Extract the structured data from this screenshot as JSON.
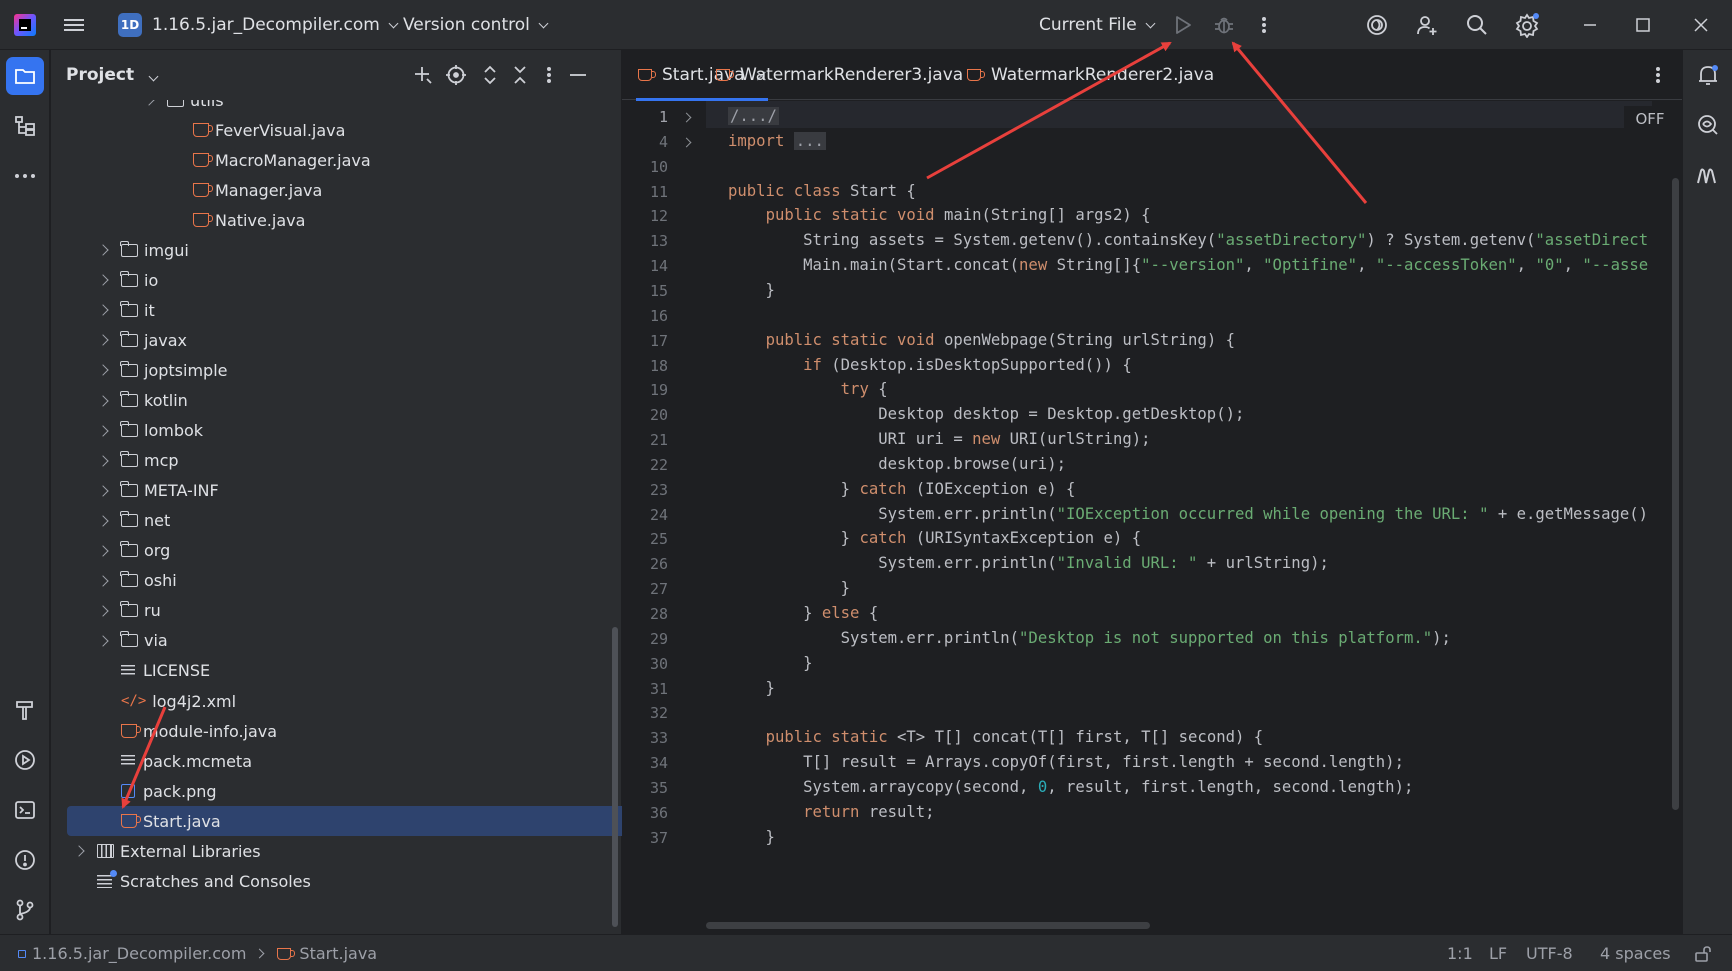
{
  "titlebar": {
    "project_badge": "1D",
    "project_name": "1.16.5.jar_Decompiler.com",
    "version_control": "Version control",
    "run_config": "Current File"
  },
  "project_panel": {
    "title": "Project",
    "tree": [
      {
        "label": "utils",
        "type": "folder",
        "depth": 2,
        "expandable": true
      },
      {
        "label": "FeverVisual.java",
        "type": "java",
        "depth": 3
      },
      {
        "label": "MacroManager.java",
        "type": "java",
        "depth": 3
      },
      {
        "label": "Manager.java",
        "type": "java",
        "depth": 3
      },
      {
        "label": "Native.java",
        "type": "java",
        "depth": 3
      },
      {
        "label": "imgui",
        "type": "folder",
        "depth": 1,
        "expandable": true
      },
      {
        "label": "io",
        "type": "folder",
        "depth": 1,
        "expandable": true
      },
      {
        "label": "it",
        "type": "folder",
        "depth": 1,
        "expandable": true
      },
      {
        "label": "javax",
        "type": "folder",
        "depth": 1,
        "expandable": true
      },
      {
        "label": "joptsimple",
        "type": "folder",
        "depth": 1,
        "expandable": true
      },
      {
        "label": "kotlin",
        "type": "folder",
        "depth": 1,
        "expandable": true
      },
      {
        "label": "lombok",
        "type": "folder",
        "depth": 1,
        "expandable": true
      },
      {
        "label": "mcp",
        "type": "folder",
        "depth": 1,
        "expandable": true
      },
      {
        "label": "META-INF",
        "type": "folder",
        "depth": 1,
        "expandable": true
      },
      {
        "label": "net",
        "type": "folder",
        "depth": 1,
        "expandable": true
      },
      {
        "label": "org",
        "type": "folder",
        "depth": 1,
        "expandable": true
      },
      {
        "label": "oshi",
        "type": "folder",
        "depth": 1,
        "expandable": true
      },
      {
        "label": "ru",
        "type": "folder",
        "depth": 1,
        "expandable": true
      },
      {
        "label": "via",
        "type": "folder",
        "depth": 1,
        "expandable": true
      },
      {
        "label": "LICENSE",
        "type": "text",
        "depth": 1
      },
      {
        "label": "log4j2.xml",
        "type": "xml",
        "depth": 1
      },
      {
        "label": "module-info.java",
        "type": "java",
        "depth": 1
      },
      {
        "label": "pack.mcmeta",
        "type": "text",
        "depth": 1
      },
      {
        "label": "pack.png",
        "type": "image",
        "depth": 1
      },
      {
        "label": "Start.java",
        "type": "java",
        "depth": 1,
        "selected": true
      },
      {
        "label": "External Libraries",
        "type": "library",
        "depth": 0,
        "expandable": true
      },
      {
        "label": "Scratches and Consoles",
        "type": "scratch",
        "depth": 0
      }
    ]
  },
  "editor": {
    "tabs": [
      {
        "label": "Start.java",
        "active": true
      },
      {
        "label": "WatermarkRenderer3.java",
        "active": false
      },
      {
        "label": "WatermarkRenderer2.java",
        "active": false
      }
    ],
    "tab_close_glyph": "×",
    "off_badge": "OFF",
    "lines": [
      {
        "n": "1",
        "fold": true,
        "html": "<span class=\"fold-box\">/.../</span>"
      },
      {
        "n": "4",
        "fold": true,
        "html": "<span class=\"kw\">import</span> <span class=\"fold-box\">...</span>"
      },
      {
        "n": "10",
        "html": ""
      },
      {
        "n": "11",
        "html": "<span class=\"kw\">public class</span> Start {"
      },
      {
        "n": "12",
        "html": "    <span class=\"kw\">public static void</span> main(String[] args2) {"
      },
      {
        "n": "13",
        "html": "        String assets = System.getenv().containsKey(<span class=\"str\">\"assetDirectory\"</span>) ? System.getenv(<span class=\"str\">\"assetDirect</span>"
      },
      {
        "n": "14",
        "html": "        Main.main(Start.concat(<span class=\"kw\">new</span> String[]{<span class=\"str\">\"--version\"</span>, <span class=\"str\">\"Optifine\"</span>, <span class=\"str\">\"--accessToken\"</span>, <span class=\"str\">\"0\"</span>, <span class=\"str\">\"--asse</span>"
      },
      {
        "n": "15",
        "html": "    }"
      },
      {
        "n": "16",
        "html": ""
      },
      {
        "n": "17",
        "html": "    <span class=\"kw\">public static void</span> openWebpage(String urlString) {"
      },
      {
        "n": "18",
        "html": "        <span class=\"kw\">if</span> (Desktop.isDesktopSupported()) {"
      },
      {
        "n": "19",
        "html": "            <span class=\"kw\">try</span> {"
      },
      {
        "n": "20",
        "html": "                Desktop desktop = Desktop.getDesktop();"
      },
      {
        "n": "21",
        "html": "                URI uri = <span class=\"kw\">new</span> URI(urlString);"
      },
      {
        "n": "22",
        "html": "                desktop.browse(uri);"
      },
      {
        "n": "23",
        "html": "            } <span class=\"kw\">catch</span> (IOException e) {"
      },
      {
        "n": "24",
        "html": "                System.err.println(<span class=\"str\">\"IOException occurred while opening the URL: \"</span> + e.getMessage()"
      },
      {
        "n": "25",
        "html": "            } <span class=\"kw\">catch</span> (URISyntaxException e) {"
      },
      {
        "n": "26",
        "html": "                System.err.println(<span class=\"str\">\"Invalid URL: \"</span> + urlString);"
      },
      {
        "n": "27",
        "html": "            }"
      },
      {
        "n": "28",
        "html": "        } <span class=\"kw\">else</span> {"
      },
      {
        "n": "29",
        "html": "            System.err.println(<span class=\"str\">\"Desktop is not supported on this platform.\"</span>);"
      },
      {
        "n": "30",
        "html": "        }"
      },
      {
        "n": "31",
        "html": "    }"
      },
      {
        "n": "32",
        "html": ""
      },
      {
        "n": "33",
        "html": "    <span class=\"kw\">public static</span> &lt;T&gt; T[] concat(T[] first, T[] second) {"
      },
      {
        "n": "34",
        "html": "        T[] result = Arrays.copyOf(first, first.length + second.length);"
      },
      {
        "n": "35",
        "html": "        System.arraycopy(second, <span class=\"num\">0</span>, result, first.length, second.length);"
      },
      {
        "n": "36",
        "html": "        <span class=\"kw\">return</span> result;"
      },
      {
        "n": "37",
        "html": "    }"
      }
    ]
  },
  "statusbar": {
    "breadcrumb_project": "1.16.5.jar_Decompiler.com",
    "breadcrumb_file": "Start.java",
    "position": "1:1",
    "line_separator": "LF",
    "encoding": "UTF-8",
    "indent": "4 spaces"
  },
  "colors": {
    "accent": "#3574f0",
    "annotation_arrow": "#e8403c",
    "java_icon": "#e8754a",
    "keyword": "#cf8e6d",
    "string": "#6aab73"
  }
}
